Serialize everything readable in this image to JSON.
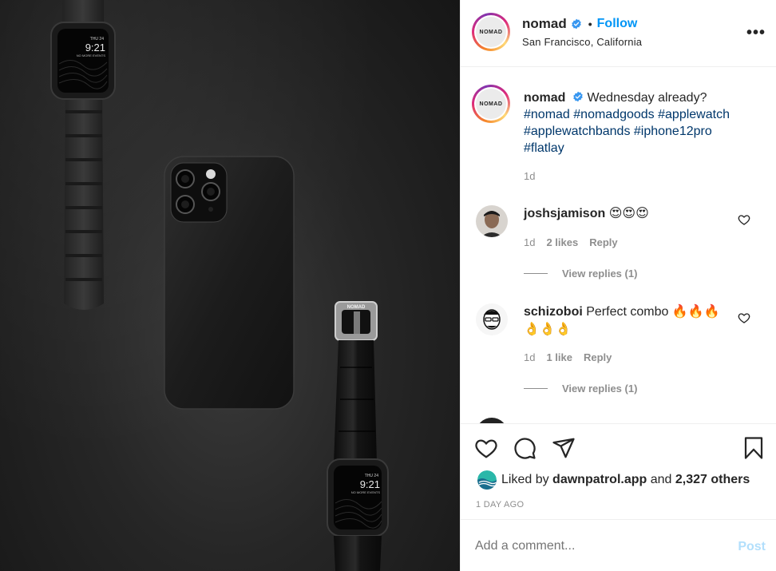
{
  "post": {
    "image_alt": "Black phone case and two Apple Watches with black bands on dark background",
    "watch_top": {
      "day": "THU 24",
      "time": "9:21",
      "subtext": "NO MORE EVENTS"
    },
    "watch_bottom": {
      "day": "THU 24",
      "time": "9:21",
      "subtext": "NO MORE EVENTS",
      "buckle_text": "NOMAD"
    }
  },
  "header": {
    "avatar_text": "NOMAD",
    "username": "nomad",
    "follow_label": "Follow",
    "location": "San Francisco, California",
    "more_icon": "more-options-icon"
  },
  "caption": {
    "avatar_text": "NOMAD",
    "username": "nomad",
    "text": "Wednesday already?",
    "hashtags_line1": "#nomad #nomadgoods #applewatch",
    "hashtags_line2": "#applewatchbands #iphone12pro",
    "hashtags_line3": "#flatlay",
    "time": "1d"
  },
  "comments": [
    {
      "username": "joshsjamison",
      "text": "😍😍😍",
      "time": "1d",
      "likes": "2 likes",
      "reply": "Reply",
      "view_replies": "View replies (1)"
    },
    {
      "username": "schizoboi",
      "text": "Perfect combo 🔥🔥🔥",
      "text_line2": "👌👌👌",
      "time": "1d",
      "likes": "1 like",
      "reply": "Reply",
      "view_replies": "View replies (1)"
    }
  ],
  "actions": {
    "like_icon": "heart-icon",
    "comment_icon": "comment-icon",
    "share_icon": "share-icon",
    "save_icon": "bookmark-icon",
    "liked_by_prefix": "Liked by",
    "liked_by_user": "dawnpatrol.app",
    "liked_by_and": "and",
    "liked_by_others": "2,327 others",
    "timestamp": "1 DAY AGO"
  },
  "add_comment": {
    "placeholder": "Add a comment...",
    "post_label": "Post"
  },
  "colors": {
    "accent": "#0095f6",
    "hashtag": "#00376b",
    "muted": "#8e8e8e",
    "post_disabled": "#b2dffc",
    "verified": "#3897f0"
  }
}
